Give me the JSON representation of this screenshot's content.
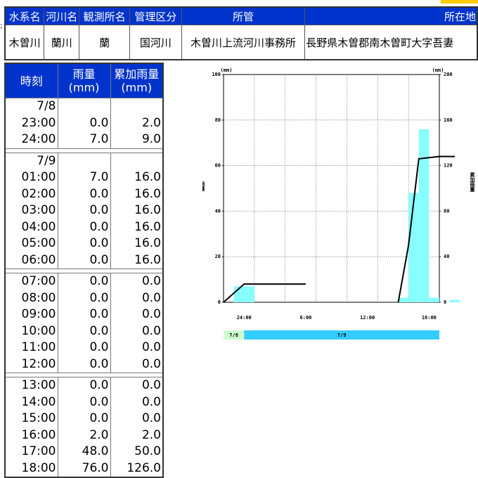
{
  "header": {
    "columns": [
      "水系名",
      "河川名",
      "観測所名",
      "管理区分",
      "所管",
      "所在地"
    ],
    "values": [
      "木曽川",
      "蘭川",
      "蘭",
      "国河川",
      "木曽川上流河川事務所",
      "長野県木曽郡南木曽町大字吾妻"
    ]
  },
  "table": {
    "headers": {
      "time": "時刻",
      "rain": "雨量\n(mm)",
      "cum": "累加雨量\n(mm)"
    },
    "groups": [
      {
        "rows": [
          {
            "time": "7/8",
            "rain": "",
            "cum": ""
          },
          {
            "time": "23:00",
            "rain": "0.0",
            "cum": "2.0"
          },
          {
            "time": "24:00",
            "rain": "7.0",
            "cum": "9.0"
          }
        ]
      },
      {
        "rows": [
          {
            "time": "7/9",
            "rain": "",
            "cum": ""
          },
          {
            "time": "01:00",
            "rain": "7.0",
            "cum": "16.0"
          },
          {
            "time": "02:00",
            "rain": "0.0",
            "cum": "16.0"
          },
          {
            "time": "03:00",
            "rain": "0.0",
            "cum": "16.0"
          },
          {
            "time": "04:00",
            "rain": "0.0",
            "cum": "16.0"
          },
          {
            "time": "05:00",
            "rain": "0.0",
            "cum": "16.0"
          },
          {
            "time": "06:00",
            "rain": "0.0",
            "cum": "16.0"
          }
        ]
      },
      {
        "rows": [
          {
            "time": "07:00",
            "rain": "0.0",
            "cum": "0.0"
          },
          {
            "time": "08:00",
            "rain": "0.0",
            "cum": "0.0"
          },
          {
            "time": "09:00",
            "rain": "0.0",
            "cum": "0.0"
          },
          {
            "time": "10:00",
            "rain": "0.0",
            "cum": "0.0"
          },
          {
            "time": "11:00",
            "rain": "0.0",
            "cum": "0.0"
          },
          {
            "time": "12:00",
            "rain": "0.0",
            "cum": "0.0"
          }
        ]
      },
      {
        "rows": [
          {
            "time": "13:00",
            "rain": "0.0",
            "cum": "0.0"
          },
          {
            "time": "14:00",
            "rain": "0.0",
            "cum": "0.0"
          },
          {
            "time": "15:00",
            "rain": "0.0",
            "cum": "0.0"
          },
          {
            "time": "16:00",
            "rain": "2.0",
            "cum": "2.0"
          },
          {
            "time": "17:00",
            "rain": "48.0",
            "cum": "50.0"
          },
          {
            "time": "18:00",
            "rain": "76.0",
            "cum": "126.0"
          }
        ]
      }
    ]
  },
  "chart_data": {
    "type": "bar",
    "left_unit": "(mm)",
    "right_unit": "(mm)",
    "left_label": "雨量",
    "right_label": "累加雨量",
    "y_left_ticks": [
      "0",
      "20",
      "40",
      "60",
      "80",
      "100"
    ],
    "y_right_ticks": [
      "0",
      "40",
      "80",
      "120",
      "160",
      "200"
    ],
    "ylim_left": [
      0,
      100
    ],
    "ylim_right": [
      0,
      200
    ],
    "x_tick_labels": [
      "24:00",
      "6:00",
      "12:00",
      "18:00"
    ],
    "date_bands": [
      "7/8",
      "7/9"
    ],
    "grid": true,
    "colors": {
      "bar": "#88ffff",
      "line": "#000000",
      "band_78": "#ccffcc",
      "band_79": "#33ccff"
    },
    "bars": [
      {
        "x": "23:00-24:00",
        "value": 7
      },
      {
        "x": "00:00-01:00",
        "value": 7
      },
      {
        "x": "15:00-16:00",
        "value": 2
      },
      {
        "x": "16:00-17:00",
        "value": 48
      },
      {
        "x": "17:00-18:00",
        "value": 76
      },
      {
        "x": "18:00-19:00",
        "value": 2
      },
      {
        "x": "19:00-20:00",
        "value": 0
      },
      {
        "x": "20:00-21:00",
        "value": 1
      }
    ],
    "cumulative": [
      {
        "x": "22:00",
        "value": 0
      },
      {
        "x": "24:00",
        "value": 16
      },
      {
        "x": "06:00",
        "value": 16
      },
      {
        "x": "15:00",
        "value": 0
      },
      {
        "x": "16:00",
        "value": 50
      },
      {
        "x": "17:00",
        "value": 126
      },
      {
        "x": "19:00",
        "value": 128
      },
      {
        "x": "20:30",
        "value": 128
      }
    ]
  }
}
